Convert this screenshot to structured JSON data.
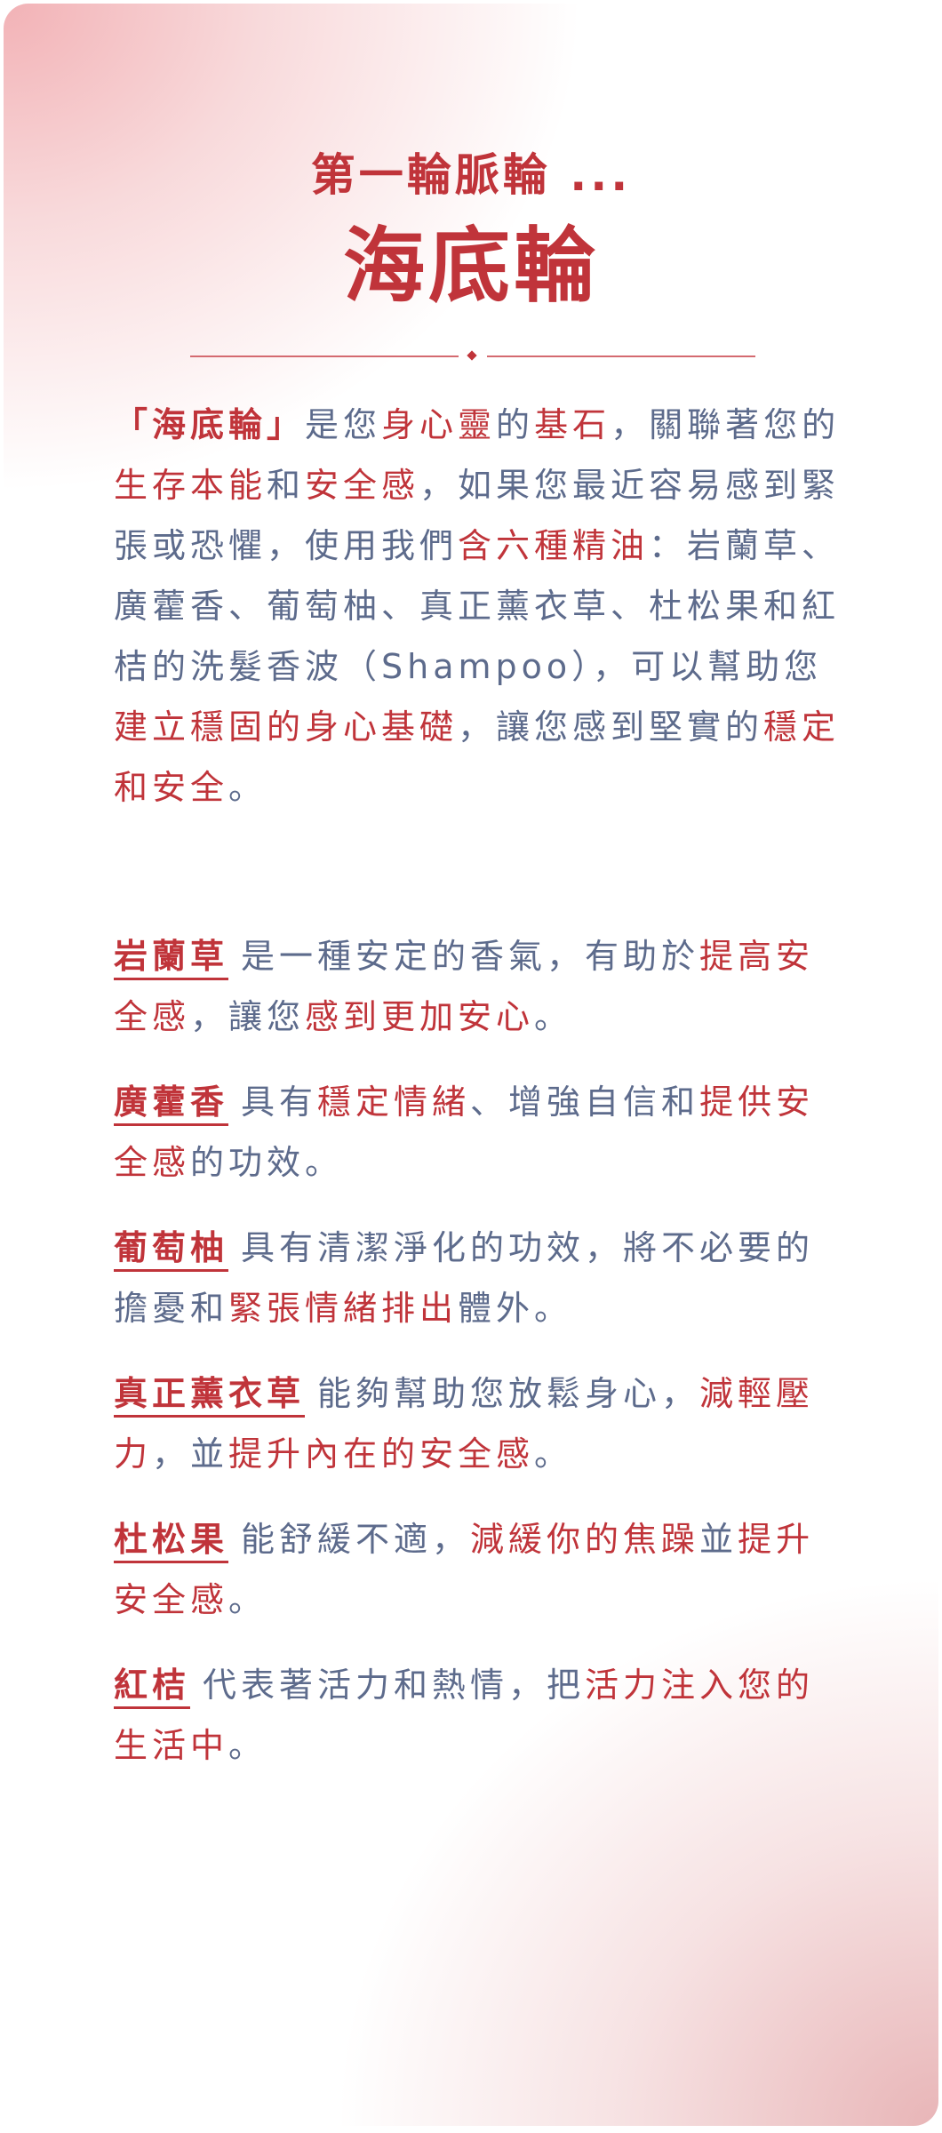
{
  "header": {
    "subtitle": "第一輪脈輪 ...",
    "title": "海底輪"
  },
  "intro": [
    {
      "t": "「海底輪」",
      "s": "hb"
    },
    {
      "t": "是您",
      "s": ""
    },
    {
      "t": "身心靈",
      "s": "hl"
    },
    {
      "t": "的",
      "s": ""
    },
    {
      "t": "基石",
      "s": "hl"
    },
    {
      "t": "，關聯著您的",
      "s": ""
    },
    {
      "t": "生存本能",
      "s": "hl"
    },
    {
      "t": "和",
      "s": ""
    },
    {
      "t": "安全感",
      "s": "hl"
    },
    {
      "t": "，如果您最近容易感到緊張或恐懼，使用我們",
      "s": ""
    },
    {
      "t": "含六種精油",
      "s": "hl"
    },
    {
      "t": "：岩蘭草、廣藿香、葡萄柚、真正薰衣草、杜松果和紅桔的洗髮香波（Shampoo），可以幫助您",
      "s": ""
    },
    {
      "t": "建立穩固的身心基礎",
      "s": "hl"
    },
    {
      "t": "，讓您感到堅實",
      "s": ""
    },
    {
      "t": "的",
      "s": ""
    },
    {
      "t": "穩定和安全",
      "s": "hl"
    },
    {
      "t": "。",
      "s": ""
    }
  ],
  "oils": [
    {
      "name": "岩蘭草",
      "parts": [
        {
          "t": "是一種安定的香氣，有助於",
          "s": ""
        },
        {
          "t": "提高安全感",
          "s": "hl"
        },
        {
          "t": "，讓您",
          "s": ""
        },
        {
          "t": "感到更加安心",
          "s": "hl"
        },
        {
          "t": "。",
          "s": ""
        }
      ]
    },
    {
      "name": "廣藿香",
      "parts": [
        {
          "t": "具有",
          "s": ""
        },
        {
          "t": "穩定情緒",
          "s": "hl"
        },
        {
          "t": "、增強自信和",
          "s": ""
        },
        {
          "t": "提供安全感",
          "s": "hl"
        },
        {
          "t": "的功效。",
          "s": ""
        }
      ]
    },
    {
      "name": "葡萄柚",
      "parts": [
        {
          "t": "具有清潔淨化的功效，將不必要的擔憂和",
          "s": ""
        },
        {
          "t": "緊張情緒排出",
          "s": "hl"
        },
        {
          "t": "體外。",
          "s": ""
        }
      ]
    },
    {
      "name": "真正薰衣草",
      "parts": [
        {
          "t": "能夠幫助您放鬆身心，",
          "s": ""
        },
        {
          "t": "減輕壓力",
          "s": "hl"
        },
        {
          "t": "，並",
          "s": ""
        },
        {
          "t": "提升內在的安全感",
          "s": "hl"
        },
        {
          "t": "。",
          "s": ""
        }
      ]
    },
    {
      "name": "杜松果",
      "parts": [
        {
          "t": "能舒緩不適，",
          "s": ""
        },
        {
          "t": "減緩你的焦躁",
          "s": "hl"
        },
        {
          "t": "並",
          "s": ""
        },
        {
          "t": "提升安全感",
          "s": "hl"
        },
        {
          "t": "。",
          "s": ""
        }
      ]
    },
    {
      "name": "紅桔",
      "parts": [
        {
          "t": "代表著活力和熱情，把",
          "s": ""
        },
        {
          "t": "活力注入您的生活中",
          "s": "hl"
        },
        {
          "t": "。",
          "s": ""
        }
      ]
    }
  ]
}
